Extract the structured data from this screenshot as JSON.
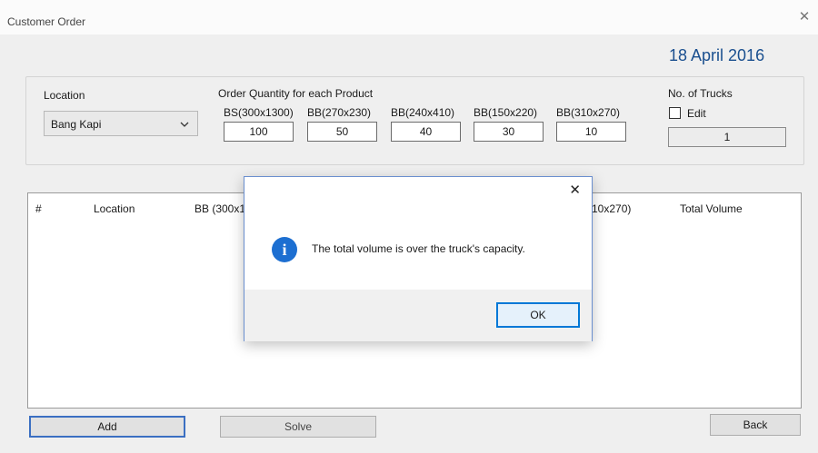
{
  "window": {
    "title": "Customer Order",
    "close_glyph": "✕"
  },
  "date": "18 April 2016",
  "location": {
    "label": "Location",
    "selected": "Bang Kapi"
  },
  "order": {
    "label": "Order Quantity for each Product",
    "products": [
      {
        "label": "BS(300x1300)",
        "value": "100"
      },
      {
        "label": "BB(270x230)",
        "value": "50"
      },
      {
        "label": "BB(240x410)",
        "value": "40"
      },
      {
        "label": "BB(150x220)",
        "value": "30"
      },
      {
        "label": "BB(310x270)",
        "value": "10"
      }
    ]
  },
  "trucks": {
    "label": "No. of Trucks",
    "edit_label": "Edit",
    "edit_checked": false,
    "value": "1"
  },
  "grid": {
    "columns": [
      "#",
      "Location",
      "BB (300x1",
      "10x270)",
      "Total Volume"
    ]
  },
  "buttons": {
    "add": "Add",
    "solve": "Solve",
    "back": "Back"
  },
  "dialog": {
    "message": "The total volume is over the truck's capacity.",
    "ok": "OK",
    "icon": "info-icon",
    "close_glyph": "✕"
  },
  "colors": {
    "date_text": "#1a4f8f",
    "info_icon": "#1d6fd1",
    "ok_border": "#0078d7"
  }
}
